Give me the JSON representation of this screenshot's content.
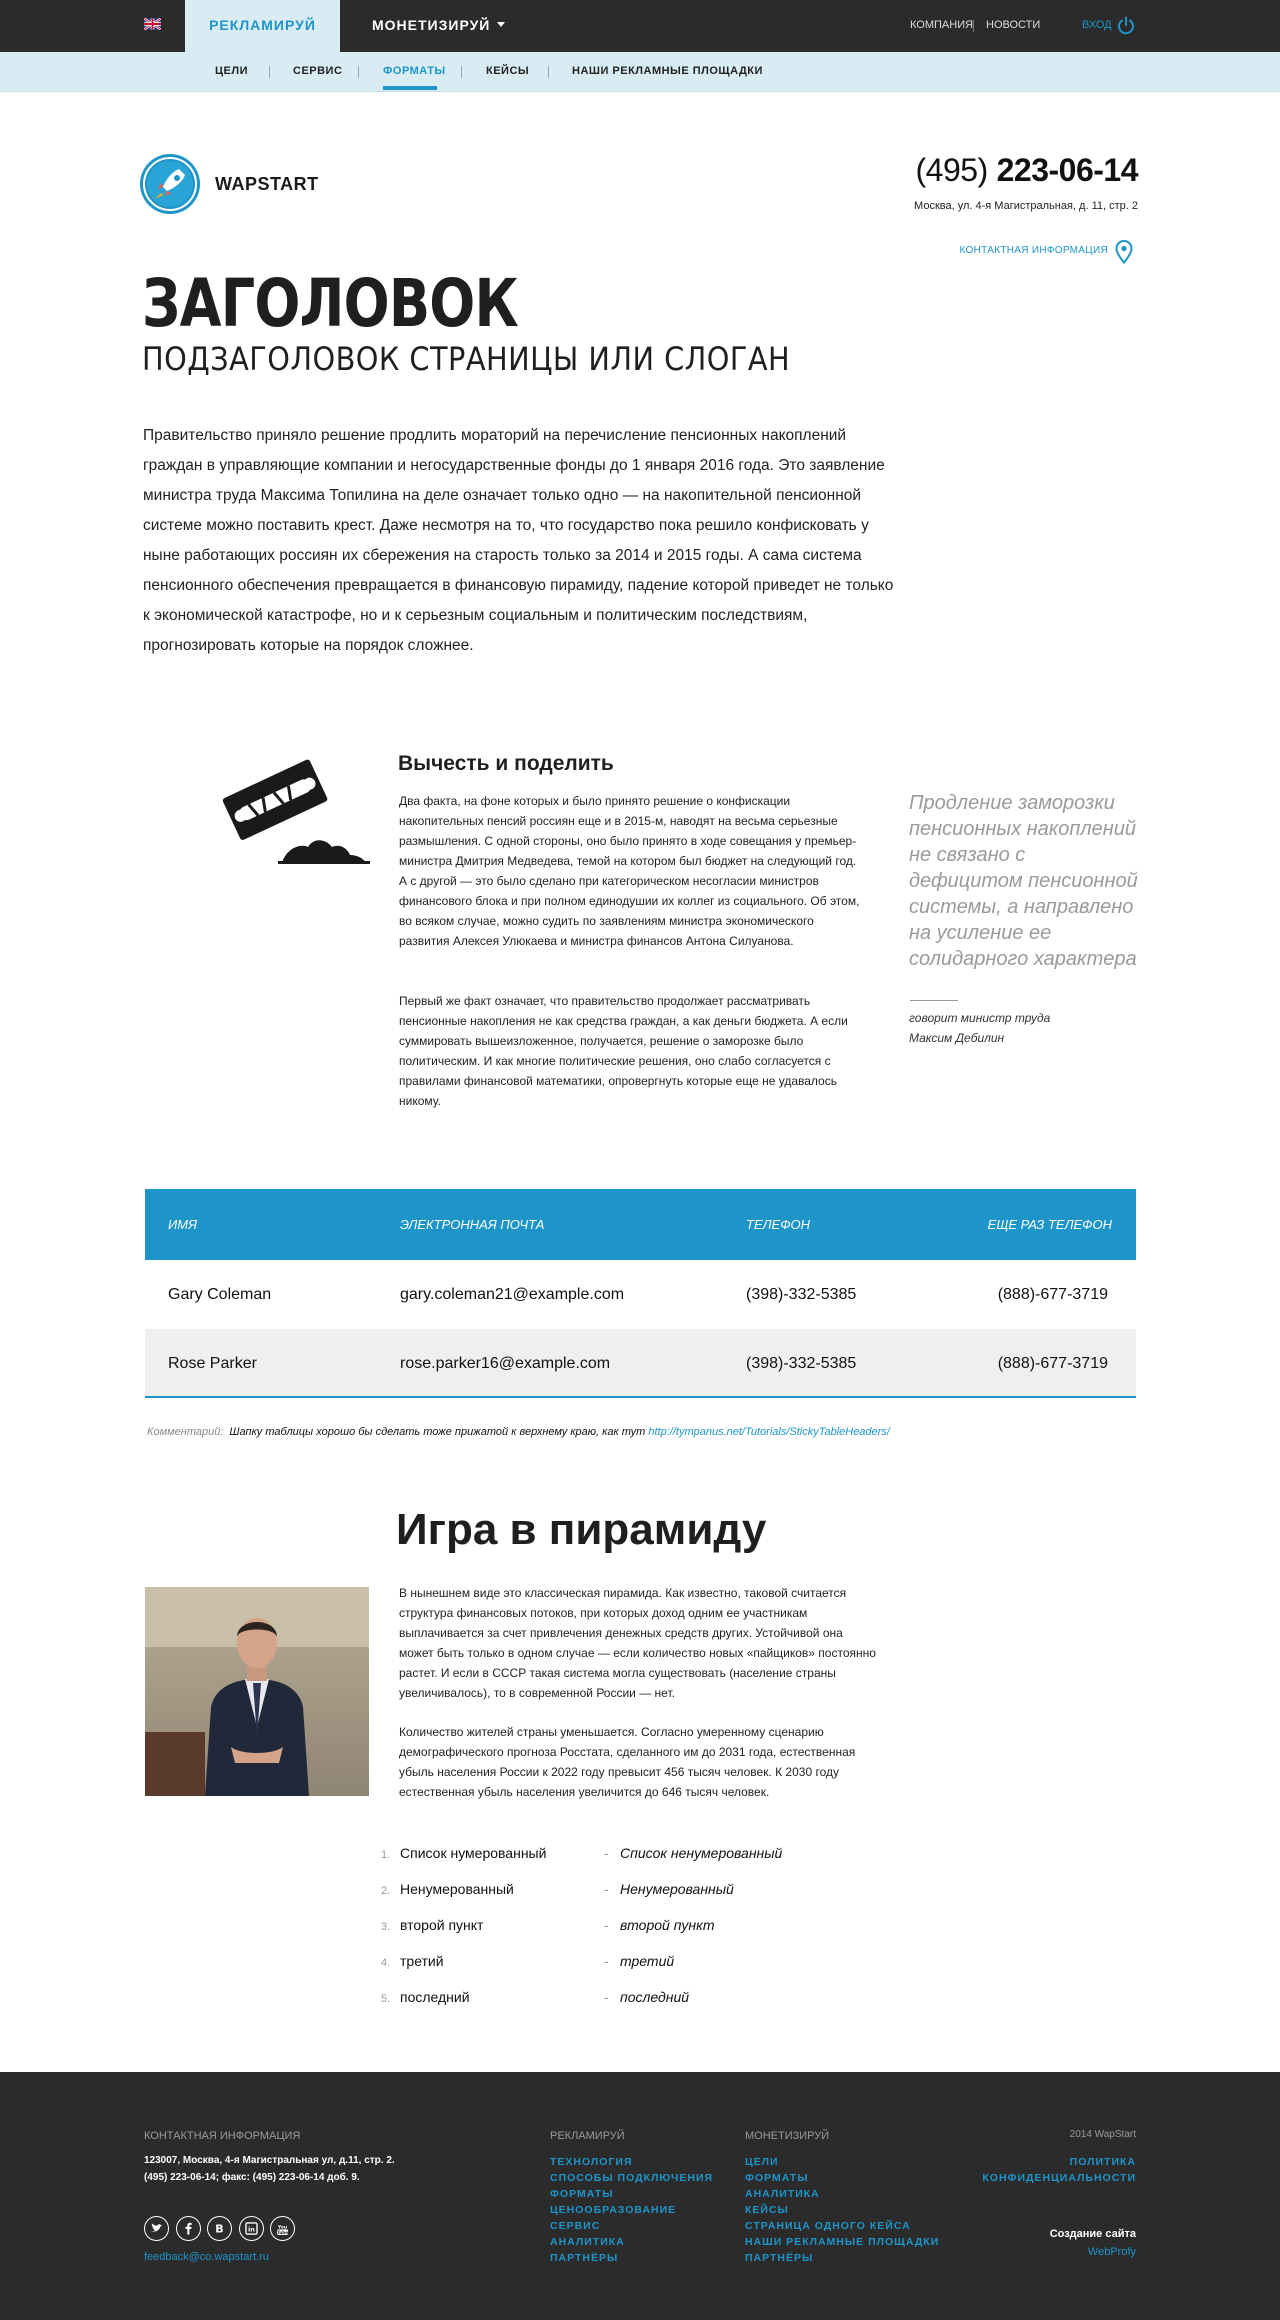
{
  "topbar": {
    "tab_advertise": "РЕКЛАМИРУЙ",
    "tab_monetize": "МОНЕТИЗИРУЙ",
    "link_company": "КОМПАНИЯ",
    "link_news": "НОВОСТИ",
    "login": "ВХОД"
  },
  "subnav": {
    "items": [
      "ЦЕЛИ",
      "СЕРВИС",
      "ФОРМАТЫ",
      "КЕЙСЫ",
      "НАШИ РЕКЛАМНЫЕ ПЛОЩАДКИ"
    ],
    "active": "ФОРМАТЫ"
  },
  "header": {
    "logo_text": "WAPSTART",
    "phone_code": "(495)",
    "phone_number": "223-06-14",
    "address": "Москва, ул. 4-я Магистральная, д. 11, стр. 2",
    "contact_link": "КОНТАКТНАЯ ИНФОРМАЦИЯ"
  },
  "page": {
    "title": "ЗАГОЛОВОК",
    "subtitle": "ПОДЗАГОЛОВОК СТРАНИЦЫ ИЛИ СЛОГАН",
    "intro": "Правительство приняло решение продлить мораторий на перечисление пенсионных накоплений граждан в управляющие компании и негосударственные фонды до 1 января 2016 года. Это заявление министра труда Максима Топилина на деле означает только одно — на накопительной пенсионной системе можно поставить крест. Даже несмотря на то, что государство пока решило конфисковать у ныне работающих россиян их сбережения на старость только за 2014 и 2015 годы. А сама система пенсионного обеспечения превращается в финансовую пирамиду, падение которой приведет не только к экономической катастрофе, но и к серьезным социальным и политическим последствиям, прогнозировать которые на порядок сложнее."
  },
  "article": {
    "title": "Вычесть и поделить",
    "p1": "Два факта, на фоне которых и было принято решение о конфискации накопительных пенсий россиян еще и в 2015-м, наводят на весьма серьезные размышления. С одной стороны, оно было принято в ходе совещания у премьер-министра Дмитрия Медведева, темой на котором был бюджет на следующий год. А с другой — это было сделано при категорическом несогласии министров финансового блока и при полном единодушии их коллег из социального. Об этом, во всяком случае, можно судить по заявлениям министра экономического развития Алексея Улюкаева и министра финансов Антона Силуанова.",
    "p2": "Первый же факт означает, что правительство продолжает рассматривать пенсионные накопления не как средства граждан, а как деньги бюджета. А если суммировать вышеизложенное, получается, решение о заморозке было политическим. И как многие политические решения, оно слабо согласуется с правилами финансовой математики, опровергнуть которые еще не удавалось никому.",
    "quote": "Продление заморозки пенсионных накоплений не связано с дефицитом пенсионной системы, а направлено на усиление ее солидарного характера",
    "quote_author_1": "говорит министр труда",
    "quote_author_2": "Максим Дебилин"
  },
  "table": {
    "headers": [
      "ИМЯ",
      "ЭЛЕКТРОННАЯ ПОЧТА",
      "ТЕЛЕФОН",
      "ЕЩЕ РАЗ ТЕЛЕФОН"
    ],
    "rows": [
      [
        "Gary Coleman",
        "gary.coleman21@example.com",
        "(398)-332-5385",
        "(888)-677-3719"
      ],
      [
        "Rose Parker",
        "rose.parker16@example.com",
        "(398)-332-5385",
        "(888)-677-3719"
      ]
    ],
    "comment_label": "Комментарий:",
    "comment_text": "Шапку таблицы хорошо бы сделать тоже прижатой к верхнему краю, как тут",
    "comment_link": "http://tympanus.net/Tutorials/StickyTableHeaders/"
  },
  "pyramid": {
    "title": "Игра в пирамиду",
    "p1": "В нынешнем виде это классическая пирамида. Как известно, таковой считается структура финансовых потоков, при которых доход одним ее участникам выплачивается за счет привлечения денежных средств других. Устойчивой она может быть только в одном случае — если количество новых «пайщиков» постоянно растет. И если в СССР такая система могла существовать (население страны увеличивалось), то в современной России — нет.",
    "p2": "Количество жителей страны уменьшается. Согласно умеренному сценарию демографического прогноза Росстата, сделанного им до 2031 года, естественная убыль населения России к 2022 году превысит 456 тысяч человек. К 2030 году естественная убыль населения увеличится до 646 тысяч человек."
  },
  "lists": {
    "ordered": [
      "Список нумерованный",
      "Ненумерованный",
      "второй пункт",
      "третий",
      "последний"
    ],
    "ordered_nums": [
      "1.",
      "2.",
      "3.",
      "4.",
      "5."
    ],
    "unordered": [
      "Список ненумерованный",
      "Ненумерованный",
      "второй пункт",
      "третий",
      "последний"
    ],
    "dash": "-"
  },
  "footer": {
    "contact_head": "КОНТАКТНАЯ ИНФОРМАЦИЯ",
    "address_1": "123007, Москва, 4-я Магистральная ул, д.11, стр. 2.",
    "address_2": "(495) 223-06-14; факс: (495) 223-06-14 доб. 9.",
    "email": "feedback@co.wapstart.ru",
    "advertise_head": "РЕКЛАМИРУЙ",
    "advertise_links": [
      "ТЕХНОЛОГИЯ",
      "СПОСОБЫ ПОДКЛЮЧЕНИЯ",
      "ФОРМАТЫ",
      "ЦЕНООБРАЗОВАНИЕ",
      "СЕРВИС",
      "АНАЛИТИКА",
      "ПАРТНЁРЫ"
    ],
    "monetize_head": "МОНЕТИЗИРУЙ",
    "monetize_links": [
      "ЦЕЛИ",
      "ФОРМАТЫ",
      "АНАЛИТИКА",
      "КЕЙСЫ",
      "СТРАНИЦА ОДНОГО КЕЙСА",
      "НАШИ РЕКЛАМНЫЕ ПЛОЩАДКИ",
      "ПАРТНЁРЫ"
    ],
    "copyright": "2014 WapStart",
    "policy_1": "ПОЛИТИКА",
    "policy_2": "КОНФИДЕНЦИАЛЬНОСТИ",
    "made_label": "Создание сайта",
    "made_by": "WebProfy",
    "social_icons": [
      "twitter-icon",
      "facebook-icon",
      "vk-icon",
      "linkedin-icon",
      "youtube-icon"
    ]
  },
  "colors": {
    "accent": "#1d95c9",
    "dark": "#2b2b2b",
    "subnav_bg": "#d9ecf3"
  }
}
